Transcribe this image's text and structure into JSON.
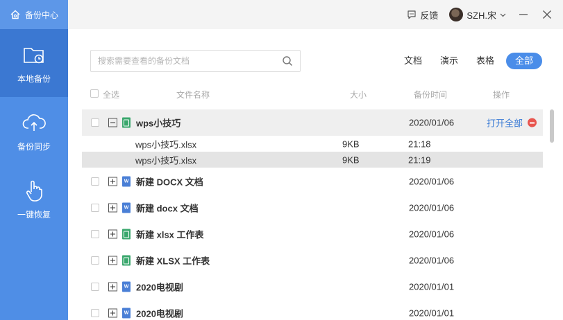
{
  "app": {
    "title": "备份中心"
  },
  "sidebar": {
    "items": [
      {
        "label": "本地备份",
        "icon": "folder-clock-icon",
        "active": true
      },
      {
        "label": "备份同步",
        "icon": "cloud-upload-icon",
        "active": false
      },
      {
        "label": "一键恢复",
        "icon": "hand-pointer-icon",
        "active": false
      }
    ]
  },
  "titlebar": {
    "feedback": "反馈",
    "user": "SZH.宋"
  },
  "search": {
    "placeholder": "搜索需要查看的备份文档"
  },
  "filters": [
    "文档",
    "演示",
    "表格",
    "全部"
  ],
  "filter_active": "全部",
  "columns": {
    "select_all": "全选",
    "name": "文件名称",
    "size": "大小",
    "time": "备份时间",
    "action": "操作"
  },
  "groups": [
    {
      "name": "wps小技巧",
      "type": "xlsx",
      "date": "2020/01/06",
      "expanded": true,
      "action": "打开全部",
      "children": [
        {
          "name": "wps小技巧.xlsx",
          "size": "9KB",
          "time": "21:18"
        },
        {
          "name": "wps小技巧.xlsx",
          "size": "9KB",
          "time": "21:19"
        }
      ]
    },
    {
      "name": "新建 DOCX 文档",
      "type": "docx",
      "date": "2020/01/06"
    },
    {
      "name": "新建 docx 文档",
      "type": "docx",
      "date": "2020/01/06"
    },
    {
      "name": "新建 xlsx 工作表",
      "type": "xlsx",
      "date": "2020/01/06"
    },
    {
      "name": "新建 XLSX 工作表",
      "type": "xlsx",
      "date": "2020/01/06"
    },
    {
      "name": "2020电视剧",
      "type": "docx",
      "date": "2020/01/01"
    },
    {
      "name": "2020电视剧",
      "type": "docx",
      "date": "2020/01/01"
    }
  ],
  "colors": {
    "sidebar": "#4f8ee6",
    "sidebar_active": "#3b78d2",
    "accent": "#4a8de9",
    "delete": "#e8554e"
  }
}
